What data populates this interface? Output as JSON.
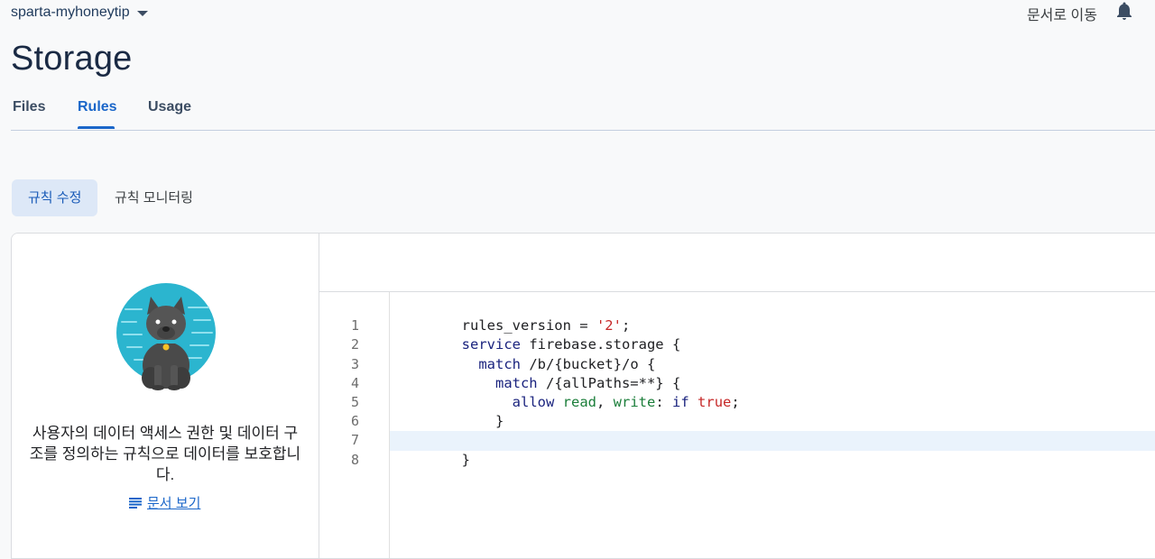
{
  "header": {
    "project_name": "sparta-myhoneytip",
    "docs_link": "문서로 이동"
  },
  "page": {
    "title": "Storage"
  },
  "tabs": [
    {
      "label": "Files"
    },
    {
      "label": "Rules"
    },
    {
      "label": "Usage"
    }
  ],
  "subtabs": [
    {
      "label": "규칙 수정"
    },
    {
      "label": "규칙 모니터링"
    }
  ],
  "info": {
    "description": "사용자의 데이터 액세스 권한 및 데이터 구조를 정의하는 규칙으로 데이터를 보호합니다.",
    "link": "문서 보기"
  },
  "editor": {
    "line_numbers": [
      "1",
      "2",
      "3",
      "4",
      "5",
      "6",
      "7",
      "8"
    ],
    "l1": {
      "a": "rules_version = ",
      "b": "'2'",
      "c": ";"
    },
    "l2": {
      "kw": "service",
      "rest": " firebase.storage {"
    },
    "l3": {
      "indent": "  ",
      "kw": "match",
      "rest": " /b/{bucket}/o {"
    },
    "l4": {
      "indent": "    ",
      "kw": "match",
      "rest": " /{allPaths=**} {"
    },
    "l5": {
      "indent": "      ",
      "kw1": "allow",
      "sp": " ",
      "id1": "read",
      "comma": ", ",
      "id2": "write",
      "colon": ": ",
      "kw2": "if",
      "sp2": " ",
      "lit": "true",
      "semi": ";"
    },
    "l6": "    }",
    "l7": "  }",
    "l8": "}"
  },
  "colors": {
    "accent": "#1a66c9",
    "keyword": "#1a237e",
    "string": "#c62828",
    "identifier": "#1b7e3a"
  }
}
